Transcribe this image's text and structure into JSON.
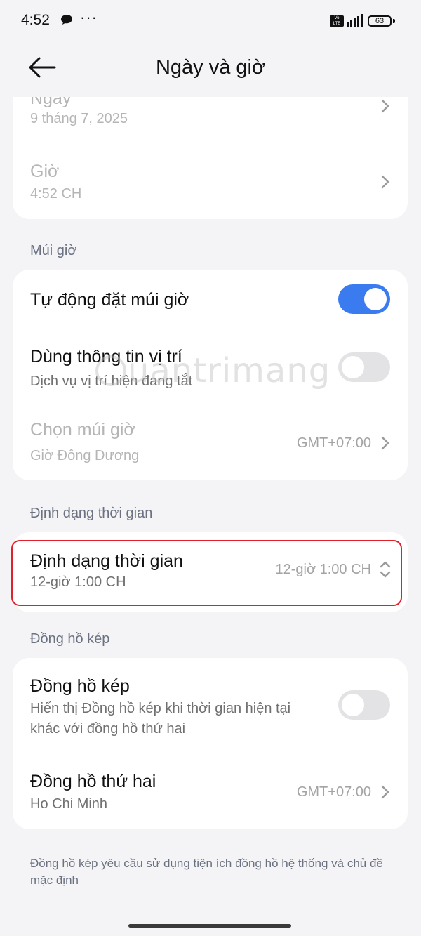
{
  "status_bar": {
    "time": "4:52",
    "more": "···",
    "network": "VoLTE",
    "battery": "63"
  },
  "header": {
    "title": "Ngày và giờ"
  },
  "date_time_card": {
    "date_label": "Ngày",
    "date_value": "9 tháng 7, 2025",
    "time_label": "Giờ",
    "time_value": "4:52 CH"
  },
  "timezone_section": {
    "title": "Múi giờ",
    "auto_label": "Tự động đặt múi giờ",
    "auto_enabled": true,
    "location_label": "Dùng thông tin vị trí",
    "location_sub": "Dịch vụ vị trí hiện đang tắt",
    "location_enabled": false,
    "choose_label": "Chọn múi giờ",
    "choose_sub": "Giờ Đông Dương",
    "choose_value": "GMT+07:00"
  },
  "time_format_section": {
    "title": "Định dạng thời gian",
    "format_label": "Định dạng thời gian",
    "format_sub": "12-giờ 1:00 CH",
    "format_value": "12-giờ 1:00 CH"
  },
  "dual_clock_section": {
    "title": "Đồng hồ kép",
    "dual_label": "Đồng hồ kép",
    "dual_sub_line1": "Hiển thị Đồng hồ kép khi thời gian hiện tại",
    "dual_sub_line2": "khác với đồng hồ thứ hai",
    "dual_enabled": false,
    "second_label": "Đồng hồ thứ hai",
    "second_sub": "Ho Chi Minh",
    "second_value": "GMT+07:00"
  },
  "footnote": "Đồng hồ kép yêu cầu sử dụng tiện ích đồng hồ hệ thống và chủ đề mặc định",
  "watermark": "uantrimang",
  "colors": {
    "accent": "#3a7bf0",
    "highlight": "#e0202a",
    "background": "#f4f4f6"
  }
}
